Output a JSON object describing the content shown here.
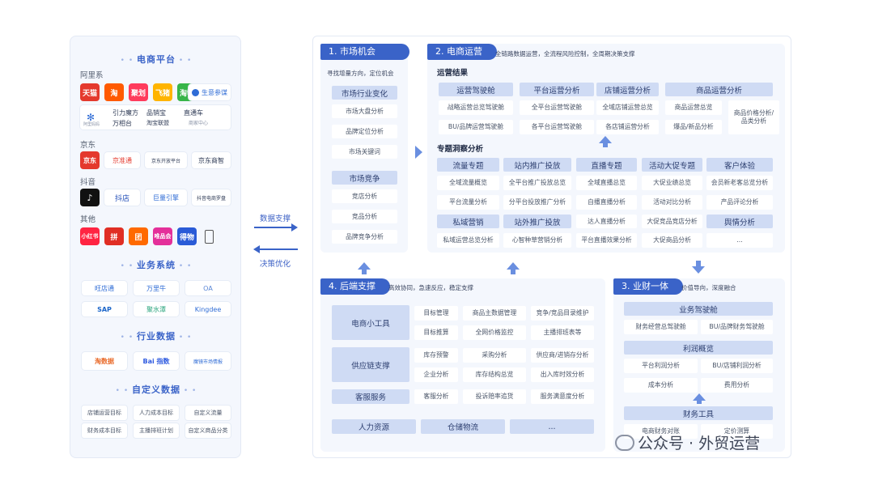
{
  "left": {
    "ecommerce_title": "电商平台",
    "ali_label": "阿里系",
    "ali_logos": [
      {
        "icon": "tmall-logo",
        "text": "天猫",
        "color": "#e4392d"
      },
      {
        "icon": "taobao-logo",
        "text": "淘",
        "color": "#ff5a00"
      },
      {
        "icon": "juhuasuan-logo",
        "text": "聚划",
        "color": "#ff3b5c"
      },
      {
        "icon": "feizhu-logo",
        "text": "飞猪",
        "color": "#ffb400"
      },
      {
        "icon": "taobao-market-logo",
        "text": "淘特",
        "color": "#38b549"
      }
    ],
    "shengyi_canmou": "生意参谋",
    "ali_tools": [
      "引力魔方",
      "品销宝",
      "直通车",
      "万相台",
      "淘宝联盟",
      "商家中心"
    ],
    "ali_tool_small": "阿里妈妈",
    "jd_label": "京东",
    "jd_items": [
      {
        "icon": "jd-logo",
        "text": "京东",
        "color": "#e4392d"
      },
      {
        "icon": "jingzhuntong-logo",
        "text": "京准通"
      },
      {
        "icon": "jd-business-logo",
        "text": "京东开放平台"
      },
      {
        "icon": "jd-shangzhi-logo",
        "text": "京东商智"
      }
    ],
    "douyin_label": "抖音",
    "douyin_items": [
      "抖店",
      "巨量引擎",
      "抖音电商罗盘"
    ],
    "other_label": "其他",
    "other_logos": [
      {
        "icon": "xiaohongshu-logo",
        "text": "小红书",
        "color": "#ff2442"
      },
      {
        "icon": "pinduoduo-logo",
        "text": "拼",
        "color": "#e02e24"
      },
      {
        "icon": "meituan-logo",
        "text": "团",
        "color": "#ff6a00"
      },
      {
        "icon": "vip-logo",
        "text": "唯品会",
        "color": "#e4309a"
      },
      {
        "icon": "dewu-logo",
        "text": "得物",
        "color": "#2a5bd7"
      }
    ],
    "biz_title": "业务系统",
    "biz_items": [
      "旺店通",
      "万里牛",
      "OA",
      "SAP",
      "聚水潭",
      "Kingdee"
    ],
    "industry_title": "行业数据",
    "industry_items": [
      "淘数据",
      "Bai 指数",
      "魔镜市场情报"
    ],
    "custom_title": "自定义数据",
    "custom_items": [
      "店铺运营目标",
      "人力成本目标",
      "自定义流量",
      "财务成本目标",
      "主播排班计划",
      "自定义商品分类"
    ]
  },
  "middle": {
    "data_support": "数据支撑",
    "decision_opt": "决策优化"
  },
  "s1": {
    "title": "1. 市场机会",
    "desc": "寻找增量方向，定位机会",
    "hdr1": "市场行业变化",
    "items1": [
      "市场大盘分析",
      "品牌定位分析",
      "市场关键词"
    ],
    "hdr2": "市场竞争",
    "items2": [
      "竞店分析",
      "竞品分析",
      "品牌竞争分析"
    ]
  },
  "s2": {
    "title": "2. 电商运营",
    "desc": "全链路数据运营，全流程风险控制，全周期决策支撑",
    "results_label": "运营结果",
    "results_headers": [
      "运营驾驶舱",
      "平台运营分析",
      "店铺运营分析",
      "商品运营分析"
    ],
    "results_cells": [
      [
        "战略运营总览驾驶舱",
        "BU/品牌运营驾驶舱"
      ],
      [
        "全平台运营驾驶舱",
        "各平台运营驾驶舱"
      ],
      [
        "全域店铺运营总览",
        "各店铺运营分析"
      ],
      [
        "商品运营总览",
        "爆品/新品分析"
      ]
    ],
    "results_extra": "商品价格分析/品类分析",
    "topic_label": "专题洞察分析",
    "topic_headers": [
      "流量专题",
      "站内推广投放",
      "直播专题",
      "活动大促专题",
      "客户体验"
    ],
    "topic_cells": [
      [
        "全域流量概览",
        "平台流量分析"
      ],
      [
        "全平台推广投放总览",
        "分平台投放推广分析"
      ],
      [
        "全域直播总览",
        "自播直播分析"
      ],
      [
        "大促业绩总览",
        "活动对比分析"
      ],
      [
        "会员新老客总览分析",
        "产品评论分析"
      ]
    ],
    "topic_headers2": [
      "私域营销",
      "站外推广投放",
      "达人直播分析",
      "大促竞品竞店分析",
      "舆情分析"
    ],
    "topic_cells2": [
      "私域运营总览分析",
      "心智种草营销分析",
      "平台直播效果分析",
      "大促商品分析",
      "..."
    ]
  },
  "s3": {
    "title": "3. 业财一体",
    "desc": "价值导向，深度融合",
    "hdr1": "业务驾驶舱",
    "cells1": [
      "财务经营总驾驶舱",
      "BU/品牌财务驾驶舱"
    ],
    "hdr2": "利润概览",
    "cells2": [
      "平台利润分析",
      "BU/店铺利润分析",
      "成本分析",
      "费用分析"
    ],
    "hdr3": "财务工具",
    "cells3": [
      "电商财务对账",
      "定价测算"
    ]
  },
  "s4": {
    "title": "4. 后端支撑",
    "desc": "高效协同，急速反应，稳定支撑",
    "row_tool": "电商小工具",
    "tool_cells": [
      "目标管理",
      "商品主数据管理",
      "竞争/竞品目录维护",
      "目标推算",
      "全网价格监控",
      "主播排班表等"
    ],
    "row_supply": "供应链支撑",
    "supply_cells": [
      "库存预警",
      "采购分析",
      "供应商/进销存分析",
      "企业分析",
      "库存结构总览",
      "出入库时效分析"
    ],
    "row_service": "客服服务",
    "service_cells": [
      "客服分析",
      "投诉赔率追货",
      "服务满意度分析"
    ],
    "bottom": [
      "人力资源",
      "仓储物流",
      "..."
    ]
  },
  "watermark": "公众号 · 外贸运营"
}
